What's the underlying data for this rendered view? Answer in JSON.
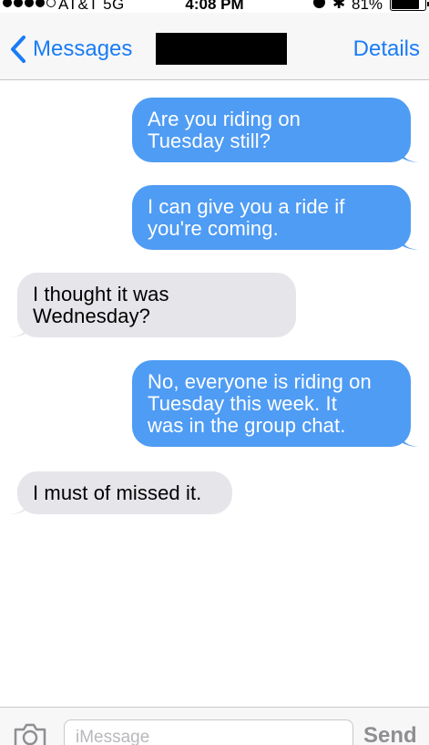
{
  "status_bar": {
    "signal_bars_filled": 4,
    "signal_bars_total": 5,
    "carrier": "AT&T  5G",
    "time": "4:08 PM",
    "battery_percent": "81%",
    "battery_level": 0.81
  },
  "nav": {
    "back_label": "Messages",
    "details_label": "Details",
    "contact_name_redacted": true
  },
  "messages": [
    {
      "direction": "outgoing",
      "text": "Are you riding on\nTuesday still?"
    },
    {
      "direction": "outgoing",
      "text": "I can give you a ride if\nyou're coming."
    },
    {
      "direction": "incoming",
      "text": "I thought it was\nWednesday?"
    },
    {
      "direction": "outgoing",
      "text": "No, everyone is riding on\nTuesday this week. It\nwas in the group chat."
    },
    {
      "direction": "incoming",
      "text": "I must of missed it."
    }
  ],
  "composer": {
    "placeholder": "iMessage",
    "send_label": "Send"
  },
  "colors": {
    "outgoing_bubble": "#4f9cf4",
    "incoming_bubble": "#e5e5ea",
    "accent": "#1a7cf4",
    "send_disabled": "#8e8e93"
  },
  "icons": {
    "back": "chevron-left-icon",
    "camera": "camera-icon",
    "bluetooth": "bluetooth-icon",
    "alarm": "alarm-icon",
    "battery": "battery-icon"
  }
}
